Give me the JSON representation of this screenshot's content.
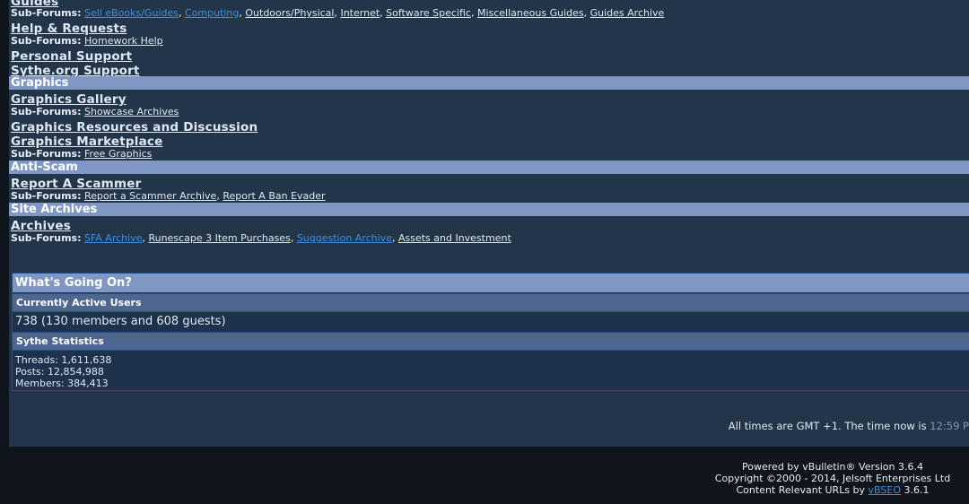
{
  "forums": {
    "guides_partial": "Guides",
    "guides_sub_label": "Sub-Forums:",
    "guides_subs": [
      "Sell eBooks/Guides",
      "Computing",
      "Outdoors/Physical",
      "Internet",
      "Software Specific",
      "Miscellaneous Guides",
      "Guides Archive"
    ],
    "help": "Help & Requests",
    "help_subs": [
      "Homework Help"
    ],
    "personal": "Personal Support",
    "sythe_support": "Sythe.org Support",
    "cat_graphics": "Graphics",
    "graphics_gallery": "Graphics Gallery",
    "graphics_gallery_subs": [
      "Showcase Archives"
    ],
    "graphics_resources": "Graphics Resources and Discussion",
    "graphics_marketplace": "Graphics Marketplace",
    "graphics_marketplace_subs": [
      "Free Graphics"
    ],
    "cat_antiscam": "Anti-Scam",
    "report_scammer": "Report A Scammer",
    "report_subs": [
      "Report a Scammer Archive",
      "Report A Ban Evader"
    ],
    "cat_archives": "Site Archives",
    "archives": "Archives",
    "archives_subs": [
      "SFA Archive",
      "Runescape 3 Item Purchases",
      "Suggestion Archive",
      "Assets and Investment"
    ]
  },
  "wgo": {
    "title": "What's Going On?",
    "active_title": "Currently Active Users",
    "active_text": "738 (130 members and 608 guests)",
    "stats_title": "Sythe Statistics",
    "threads": "Threads: 1,611,638",
    "posts": "Posts: 12,854,988",
    "members": "Members: 384,413"
  },
  "time": {
    "prefix": "All times are GMT +1. The time now is",
    "value": "12:59 P"
  },
  "footer": {
    "powered": "Powered by vBulletin® Version 3.6.4",
    "copyright": "Copyright ©2000 - 2014, Jelsoft Enterprises Ltd",
    "seo_prefix": "Content Relevant URLs by",
    "seo_link": "vBSEO",
    "seo_version": "3.6.1"
  },
  "colors": {
    "page_bg": "#233549",
    "category_bar": "#8197c3",
    "link_blue": "#3f8ee0"
  }
}
